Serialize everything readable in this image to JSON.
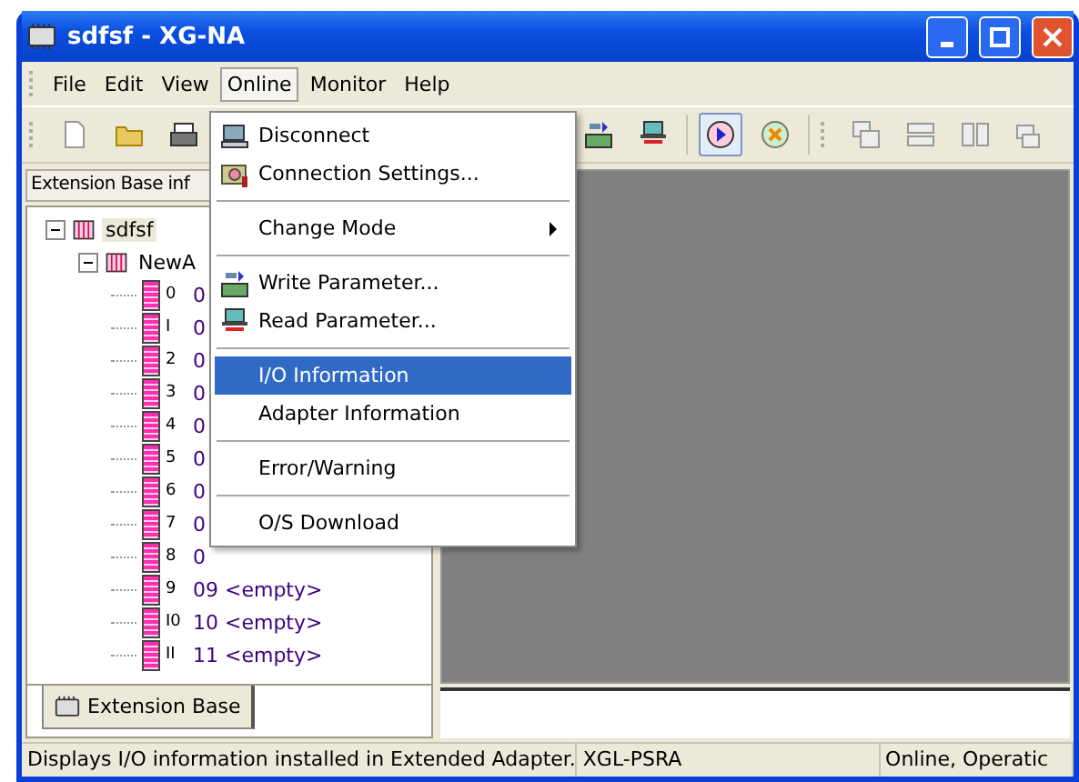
{
  "window": {
    "title": "sdfsf - XG-NA"
  },
  "menu_bar": [
    {
      "label": "File",
      "selected": false
    },
    {
      "label": "Edit",
      "selected": false
    },
    {
      "label": "View",
      "selected": false
    },
    {
      "label": "Online",
      "selected": true
    },
    {
      "label": "Monitor",
      "selected": false
    },
    {
      "label": "Help",
      "selected": false
    }
  ],
  "online_menu": [
    {
      "kind": "item",
      "label": "Disconnect",
      "selected": false
    },
    {
      "kind": "item",
      "label": "Connection Settings...",
      "selected": false
    },
    {
      "kind": "separator"
    },
    {
      "kind": "submenu",
      "label": "Change Mode",
      "selected": false
    },
    {
      "kind": "separator"
    },
    {
      "kind": "item",
      "label": "Write Parameter...",
      "selected": false
    },
    {
      "kind": "item",
      "label": "Read Parameter...",
      "selected": false
    },
    {
      "kind": "separator"
    },
    {
      "kind": "item",
      "label": "I/O Information",
      "selected": true
    },
    {
      "kind": "item",
      "label": "Adapter Information",
      "selected": false
    },
    {
      "kind": "separator"
    },
    {
      "kind": "item",
      "label": "Error/Warning",
      "selected": false
    },
    {
      "kind": "separator"
    },
    {
      "kind": "item",
      "label": "O/S Download",
      "selected": false
    }
  ],
  "left_panel": {
    "header": "Extension Base inf",
    "tree": [
      {
        "label": "sdfsf",
        "expanded": true,
        "selected": true,
        "children": [
          {
            "label": "NewA",
            "expanded": true,
            "selected": false,
            "children": [
              {
                "slot": "0",
                "label": "0"
              },
              {
                "slot": "I",
                "label": "0"
              },
              {
                "slot": "2",
                "label": "0"
              },
              {
                "slot": "3",
                "label": "0"
              },
              {
                "slot": "4",
                "label": "0"
              },
              {
                "slot": "5",
                "label": "0"
              },
              {
                "slot": "6",
                "label": "0"
              },
              {
                "slot": "7",
                "label": "0"
              },
              {
                "slot": "8",
                "label": "0"
              },
              {
                "slot": "9",
                "label": "09 <empty>"
              },
              {
                "slot": "I0",
                "label": "10 <empty>"
              },
              {
                "slot": "II",
                "label": "11 <empty>"
              }
            ]
          }
        ]
      }
    ],
    "tab": {
      "label": "Extension Base",
      "selected": true
    }
  },
  "status_bar": [
    "Displays I/O information installed in Extended Adapter.",
    "XGL-PSRA",
    "Online, Operatic"
  ]
}
